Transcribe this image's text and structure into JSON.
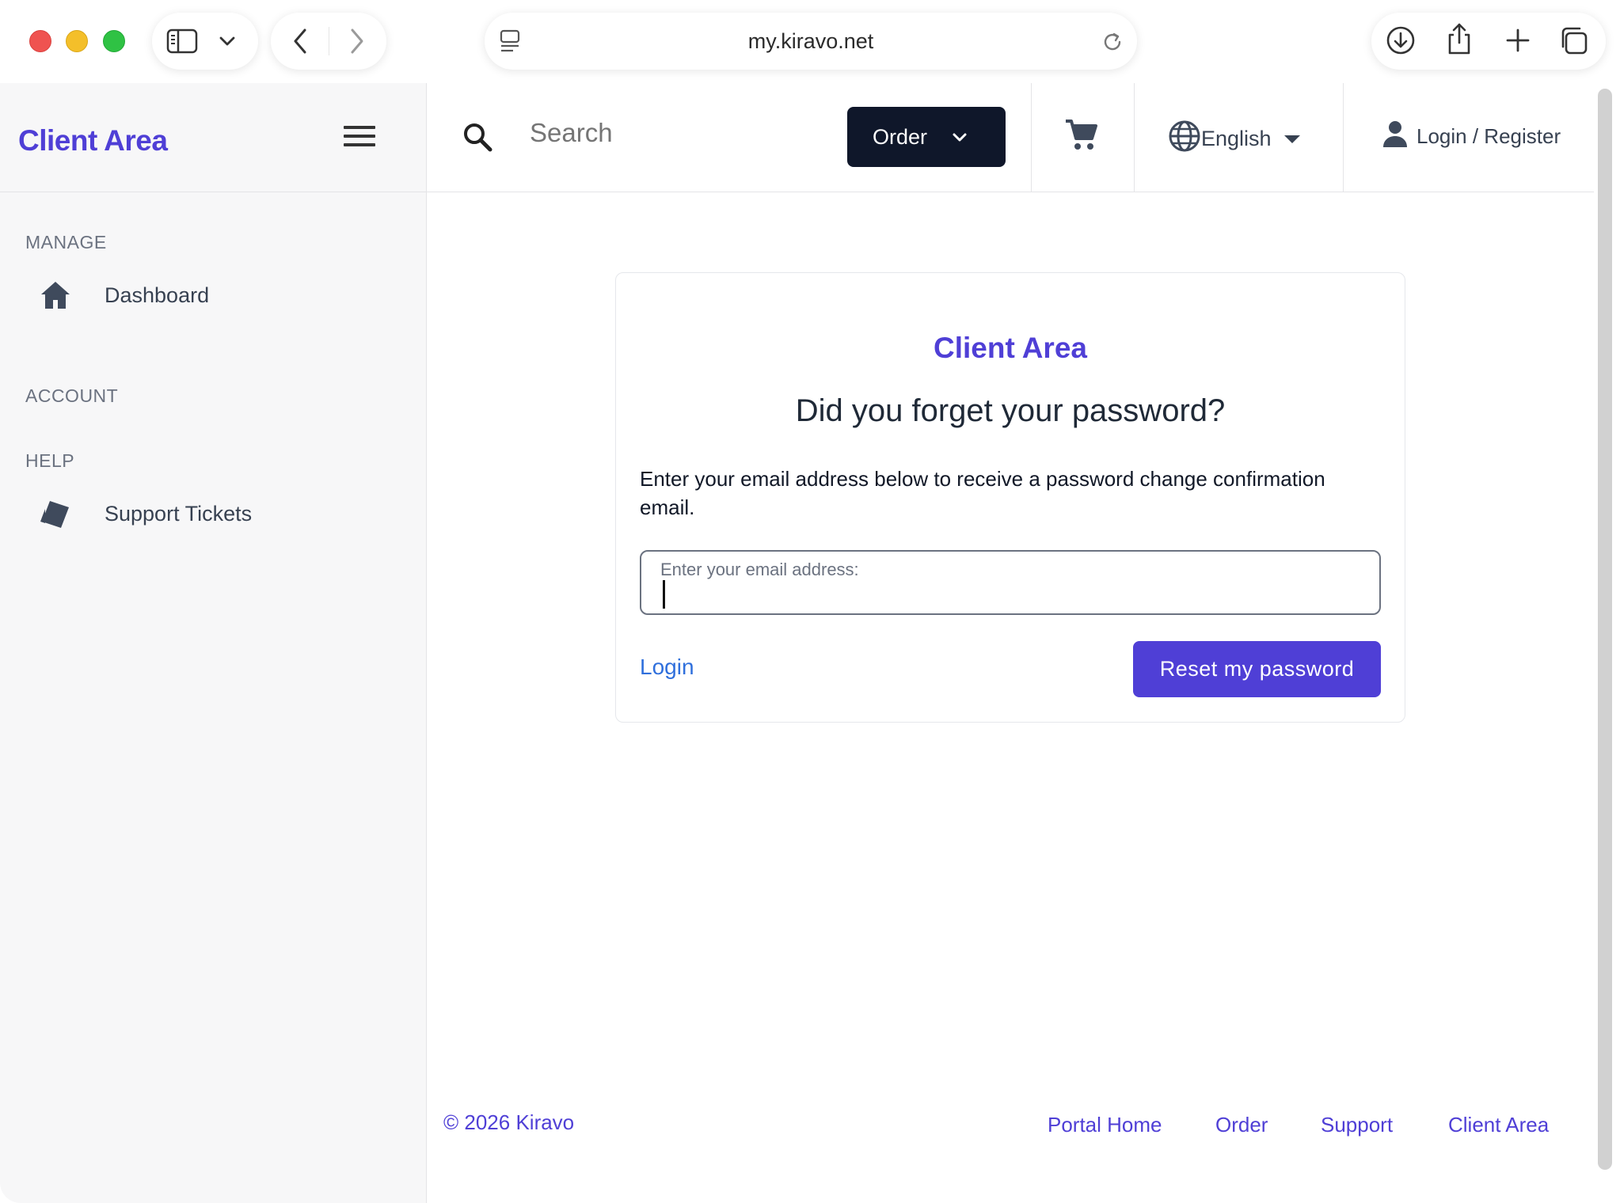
{
  "browser": {
    "url": "my.kiravo.net"
  },
  "sidebar": {
    "brand": "Client Area",
    "sections": {
      "manage": "MANAGE",
      "account": "ACCOUNT",
      "help": "HELP"
    },
    "items": [
      {
        "label": "Dashboard",
        "icon": "home-icon"
      },
      {
        "label": "Support Tickets",
        "icon": "tickets-icon"
      }
    ]
  },
  "topbar": {
    "search_placeholder": "Search",
    "order_label": "Order",
    "language_label": "English",
    "login_register_label": "Login / Register"
  },
  "card": {
    "brand": "Client Area",
    "title": "Did you forget your password?",
    "description": "Enter your email address below to receive a password change confirmation email.",
    "email_placeholder": "Enter your email address:",
    "email_value": "",
    "login_link": "Login",
    "reset_button": "Reset my password"
  },
  "footer": {
    "copyright": "© 2026 Kiravo",
    "links": [
      "Portal Home",
      "Order",
      "Support",
      "Client Area"
    ]
  },
  "colors": {
    "brand": "#4f3fd6",
    "order_button": "#0f172a",
    "link": "#2f6fdc"
  }
}
